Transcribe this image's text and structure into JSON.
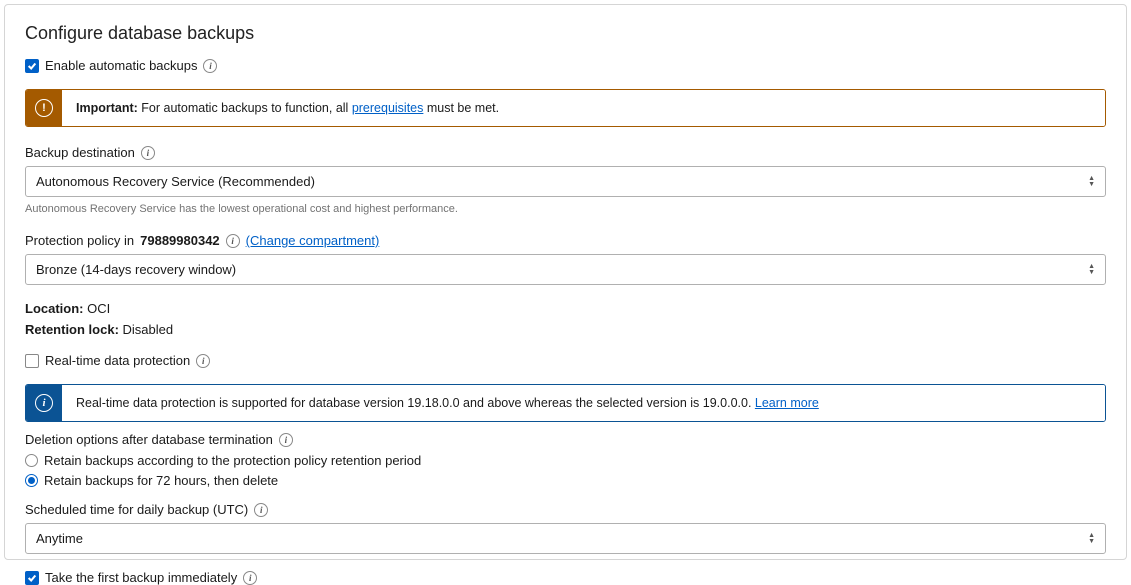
{
  "title": "Configure database backups",
  "enable_backups": {
    "label": "Enable automatic backups",
    "checked": true
  },
  "important_alert": {
    "prefix": "Important:",
    "text_before": " For automatic backups to function, all ",
    "link": "prerequisites",
    "text_after": " must be met."
  },
  "backup_destination": {
    "label": "Backup destination",
    "value": "Autonomous Recovery Service (Recommended)",
    "helper": "Autonomous Recovery Service has the lowest operational cost and highest performance."
  },
  "protection_policy": {
    "label_prefix": "Protection policy in ",
    "compartment": "79889980342",
    "change_link": "(Change compartment)",
    "value": "Bronze (14-days recovery window)"
  },
  "location": {
    "label": "Location:",
    "value": "OCI"
  },
  "retention_lock": {
    "label": "Retention lock:",
    "value": "Disabled"
  },
  "realtime_protection": {
    "label": "Real-time data protection",
    "checked": false
  },
  "realtime_alert": {
    "text": "Real-time data protection is supported for database version 19.18.0.0 and above whereas the selected version is 19.0.0.0. ",
    "link": "Learn more"
  },
  "deletion_options": {
    "label": "Deletion options after database termination",
    "options": [
      {
        "label": "Retain backups according to the protection policy retention period",
        "selected": false
      },
      {
        "label": "Retain backups for 72 hours, then delete",
        "selected": true
      }
    ]
  },
  "scheduled_time": {
    "label": "Scheduled time for daily backup (UTC)",
    "value": "Anytime"
  },
  "first_backup": {
    "label": "Take the first backup immediately",
    "checked": true
  }
}
